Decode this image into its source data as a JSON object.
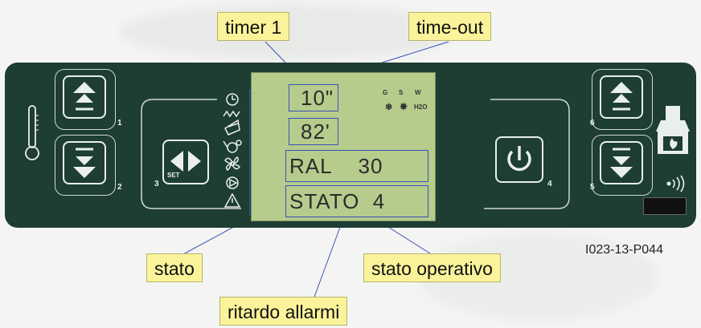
{
  "callouts": {
    "timer": "timer 1",
    "timeout": "time-out",
    "stato": "stato",
    "stato_operativo": "stato operativo",
    "ritardo": "ritardo allarmi"
  },
  "figure_code": "I023-13-P044",
  "lcd": {
    "field1": "10\"",
    "field2": "82'",
    "field3": "RAL    30",
    "field4": "STATO  4",
    "indicator_labels": [
      "G",
      "S",
      "W"
    ],
    "h2o_label": "H2O"
  },
  "buttons": {
    "b1": "1",
    "b2": "2",
    "b3": "3",
    "set": "SET",
    "b4": "4",
    "b5": "5",
    "b6": "6"
  },
  "colors": {
    "panel": "#1e3d33",
    "lcd": "#b5cc8c",
    "callout": "#fbf39a",
    "field_border": "#3c50b8"
  },
  "icons": [
    "thermometer-icon",
    "clock-icon",
    "heater-icon",
    "fan-icon",
    "pump-icon",
    "alarm-icon",
    "power-icon",
    "fireplace-icon",
    "wireless-icon"
  ]
}
